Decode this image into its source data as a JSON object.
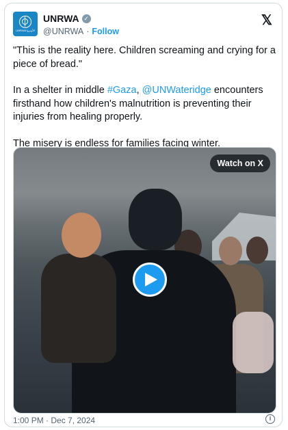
{
  "account": {
    "name": "UNRWA",
    "handle": "@UNRWA",
    "separator": "·",
    "follow_label": "Follow",
    "avatar_text": "UNRWA الأونروا"
  },
  "logo": {
    "icon": "x-logo-icon",
    "glyph": "𝕏"
  },
  "tweet": {
    "para1": "\"This is the reality here. Children screaming and crying for a piece of bread.\"",
    "para2_prefix": "In a shelter in middle ",
    "hashtag": "#Gaza",
    "para2_sep": ", ",
    "mention": "@UNWateridge",
    "para2_suffix": " encounters firsthand how children's malnutrition is preventing their injuries from healing properly.",
    "para3": "The misery is endless for families facing winter."
  },
  "media": {
    "watch_label": "Watch on X",
    "play_icon": "play-icon"
  },
  "footer": {
    "timestamp": "1:00 PM · Dec 7, 2024",
    "info_glyph": "i"
  },
  "colors": {
    "accent": "#1d9bf0",
    "secondary_text": "#536471",
    "avatar_bg": "#1b86c6"
  }
}
